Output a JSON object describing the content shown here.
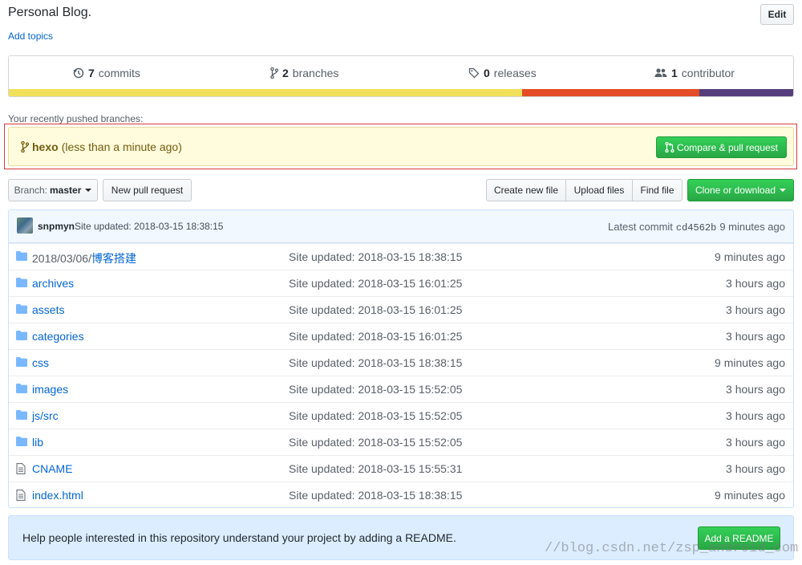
{
  "header": {
    "description": "Personal Blog.",
    "add_topics": "Add topics",
    "edit_label": "Edit"
  },
  "summary": {
    "commits": {
      "count": "7",
      "label": "commits",
      "icon": "history-icon"
    },
    "branches": {
      "count": "2",
      "label": "branches",
      "icon": "git-branch-icon"
    },
    "releases": {
      "count": "0",
      "label": "releases",
      "icon": "tag-icon"
    },
    "contributors": {
      "count": "1",
      "label": "contributor",
      "icon": "people-icon"
    }
  },
  "language_bar": [
    {
      "color": "#f1e05a",
      "fraction": 0.654
    },
    {
      "color": "#e34c26",
      "fraction": 0.226
    },
    {
      "color": "#563d7c",
      "fraction": 0.12
    }
  ],
  "recent": {
    "label": "Your recently pushed branches:",
    "branch": "hexo",
    "time": "(less than a minute ago)",
    "compare_label": "Compare & pull request"
  },
  "toolbar": {
    "branch_prefix": "Branch:",
    "branch_name": "master",
    "new_pr": "New pull request",
    "create_file": "Create new file",
    "upload_files": "Upload files",
    "find_file": "Find file",
    "clone": "Clone or download"
  },
  "latest_commit": {
    "author": "snpmyn",
    "message": "Site updated: 2018-03-15 18:38:15",
    "prefix": "Latest commit",
    "sha": "cd4562b",
    "age": "9 minutes ago"
  },
  "files": [
    {
      "type": "dir",
      "prefix": "2018/03/06/",
      "name": "博客搭建",
      "message": "Site updated: 2018-03-15 18:38:15",
      "age": "9 minutes ago"
    },
    {
      "type": "dir",
      "prefix": "",
      "name": "archives",
      "message": "Site updated: 2018-03-15 16:01:25",
      "age": "3 hours ago"
    },
    {
      "type": "dir",
      "prefix": "",
      "name": "assets",
      "message": "Site updated: 2018-03-15 16:01:25",
      "age": "3 hours ago"
    },
    {
      "type": "dir",
      "prefix": "",
      "name": "categories",
      "message": "Site updated: 2018-03-15 16:01:25",
      "age": "3 hours ago"
    },
    {
      "type": "dir",
      "prefix": "",
      "name": "css",
      "message": "Site updated: 2018-03-15 18:38:15",
      "age": "9 minutes ago"
    },
    {
      "type": "dir",
      "prefix": "",
      "name": "images",
      "message": "Site updated: 2018-03-15 15:52:05",
      "age": "3 hours ago"
    },
    {
      "type": "dir",
      "prefix": "",
      "name": "js/src",
      "message": "Site updated: 2018-03-15 15:52:05",
      "age": "3 hours ago"
    },
    {
      "type": "dir",
      "prefix": "",
      "name": "lib",
      "message": "Site updated: 2018-03-15 15:52:05",
      "age": "3 hours ago"
    },
    {
      "type": "file",
      "prefix": "",
      "name": "CNAME",
      "message": "Site updated: 2018-03-15 15:55:31",
      "age": "3 hours ago"
    },
    {
      "type": "file",
      "prefix": "",
      "name": "index.html",
      "message": "Site updated: 2018-03-15 18:38:15",
      "age": "9 minutes ago"
    }
  ],
  "readme": {
    "text": "Help people interested in this repository understand your project by adding a README.",
    "button": "Add a README"
  },
  "watermark": "//blog.csdn.net/zsp_android_com"
}
